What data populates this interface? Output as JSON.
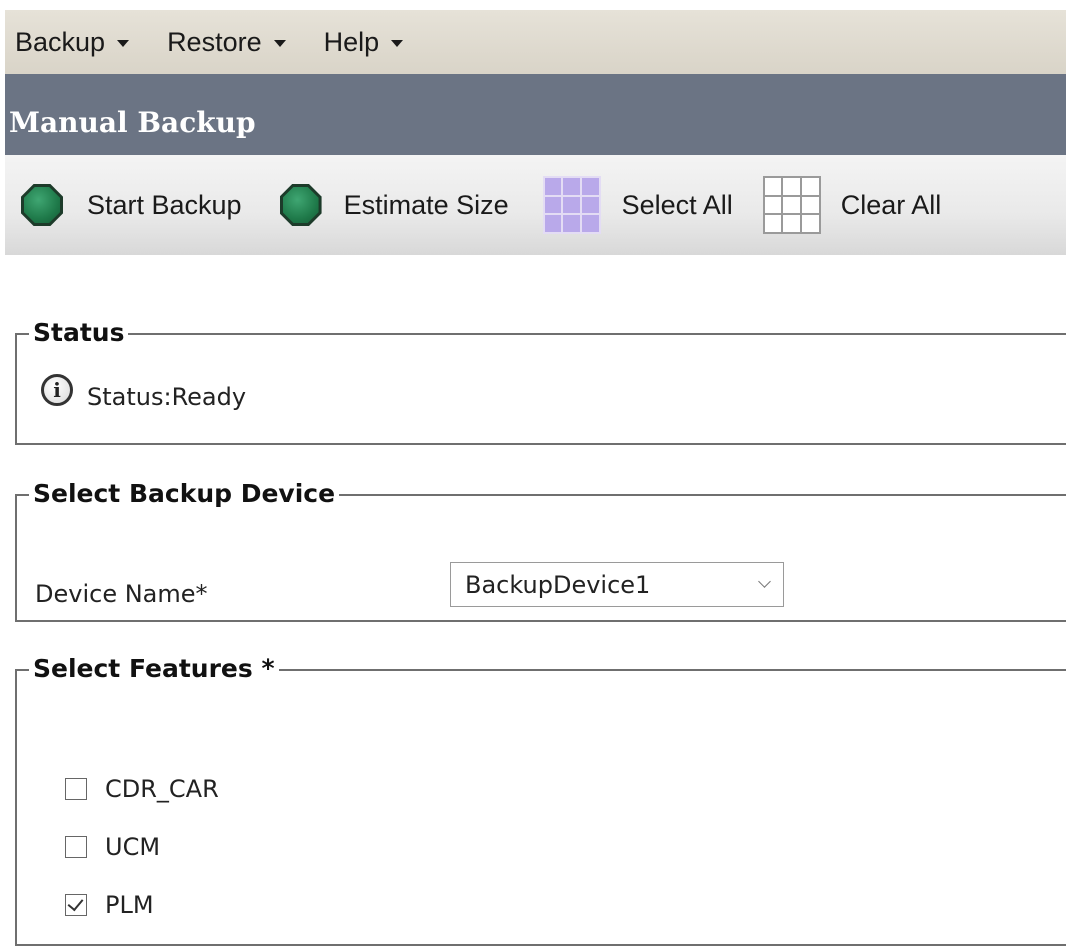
{
  "menubar": {
    "items": [
      {
        "label": "Backup"
      },
      {
        "label": "Restore"
      },
      {
        "label": "Help"
      }
    ]
  },
  "title": "Manual Backup",
  "toolbar": {
    "start_backup": "Start Backup",
    "estimate_size": "Estimate Size",
    "select_all": "Select All",
    "clear_all": "Clear All"
  },
  "status_section": {
    "legend": "Status",
    "text": "Status:Ready"
  },
  "device_section": {
    "legend": "Select Backup Device",
    "device_label": "Device Name*",
    "device_value": "BackupDevice1"
  },
  "features_section": {
    "legend": "Select Features *",
    "items": [
      {
        "label": "CDR_CAR",
        "checked": false
      },
      {
        "label": "UCM",
        "checked": false
      },
      {
        "label": "PLM",
        "checked": true
      }
    ]
  },
  "colors": {
    "title_bar": "#6b7484",
    "menu_bar": "#e0dbcf",
    "button_green": "#1f7a4a",
    "select_all_grid": "#b9a9ea"
  }
}
